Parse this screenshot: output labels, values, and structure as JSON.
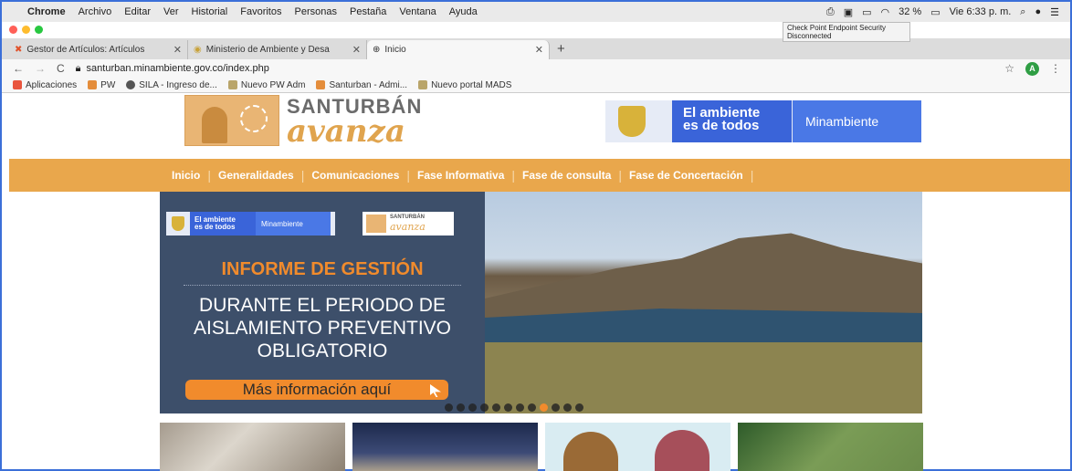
{
  "menubar": {
    "app": "Chrome",
    "items": [
      "Archivo",
      "Editar",
      "Ver",
      "Historial",
      "Favoritos",
      "Personas",
      "Pestaña",
      "Ventana",
      "Ayuda"
    ],
    "battery": "32 %",
    "clock": "Vie 6:33 p. m.",
    "tooltip": "Check Point Endpoint Security Disconnected"
  },
  "tabs": [
    {
      "title": "Gestor de Artículos: Artículos",
      "icon": "joomla-icon"
    },
    {
      "title": "Ministerio de Ambiente y Desa",
      "icon": "ministerio-icon"
    },
    {
      "title": "Inicio",
      "icon": "globe-icon"
    }
  ],
  "address": {
    "url": "santurban.minambiente.gov.co/index.php",
    "avatar_letter": "A"
  },
  "bookmarks": [
    "Aplicaciones",
    "PW",
    "SILA - Ingreso de...",
    "Nuevo PW Adm",
    "Santurban - Admi...",
    "Nuevo portal MADS"
  ],
  "header": {
    "logo_title": "SANTURBÁN",
    "logo_sub": "avanza",
    "gov_line1": "El ambiente",
    "gov_line2": "es de todos",
    "gov_brand": "Minambiente"
  },
  "nav": [
    "Inicio",
    "Generalidades",
    "Comunicaciones",
    "Fase Informativa",
    "Fase de consulta",
    "Fase de Concertación"
  ],
  "hero": {
    "mini_gov1": "El ambiente",
    "mini_gov2": "es de todos",
    "mini_brand": "Minambiente",
    "mini_sant": "SANTURBÁN",
    "mini_avanza": "avanza",
    "title": "INFORME DE GESTIÓN",
    "line1": "DURANTE EL PERIODO DE",
    "line2": "AISLAMIENTO PREVENTIVO",
    "line3": "OBLIGATORIO",
    "cta": "Más información aquí",
    "slide_count": 12,
    "active_slide": 9
  },
  "colors": {
    "accent": "#e9a74c",
    "navy": "#3d4f6a",
    "orange": "#f18b2c",
    "gov_blue": "#3a64d9"
  }
}
